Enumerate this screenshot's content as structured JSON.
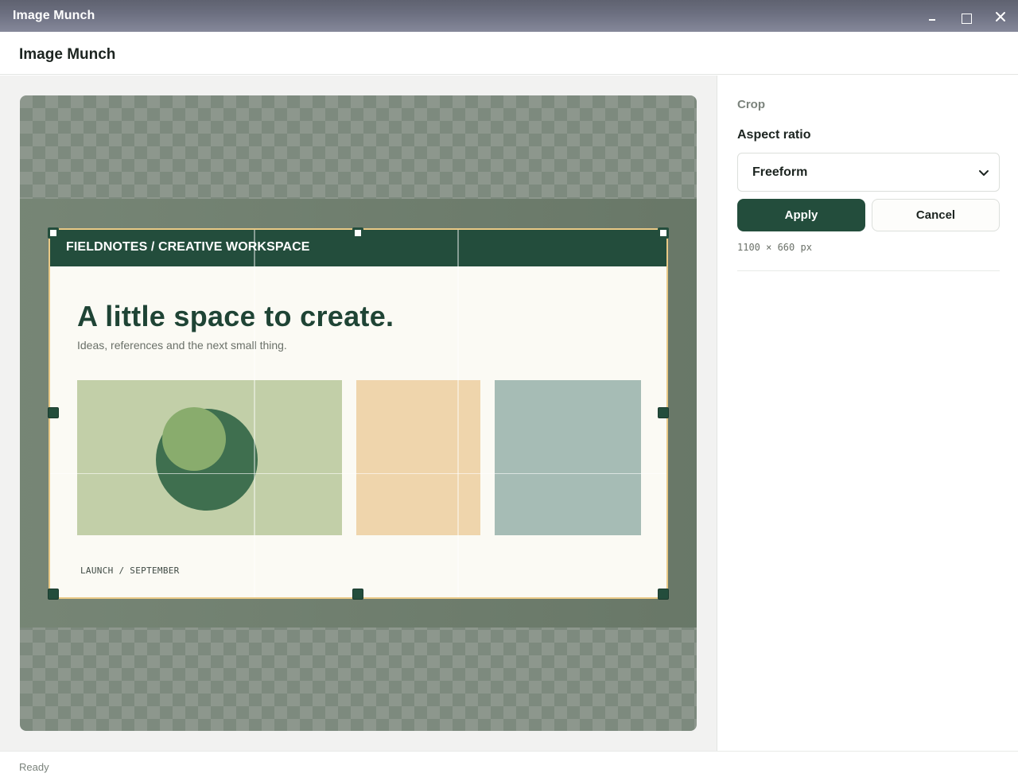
{
  "window": {
    "title": "Image Munch",
    "controls": [
      "minimize-icon",
      "maximize-icon",
      "close-icon"
    ]
  },
  "header": {
    "title": "Image Munch"
  },
  "canvas": {
    "image": {
      "brand": "FIELDNOTES / CREATIVE WORKSPACE",
      "headline": "A little space to create.",
      "subheadline": "Ideas, references and the next small thing.",
      "caption": "LAUNCH / SEPTEMBER",
      "tile_colors": [
        "#c2cfa8",
        "#efd5ac",
        "#a6bcb5"
      ]
    }
  },
  "sidebar": {
    "section_label": "Crop",
    "aspect_ratio_label": "Aspect ratio",
    "aspect_ratio_value": "Freeform",
    "apply_label": "Apply",
    "cancel_label": "Cancel",
    "dimensions": "1100 × 660 px"
  },
  "status": {
    "text": "Ready"
  },
  "colors": {
    "accent": "#234d3c",
    "crop_border": "#e9c986",
    "titlebar": "#6d7081"
  }
}
